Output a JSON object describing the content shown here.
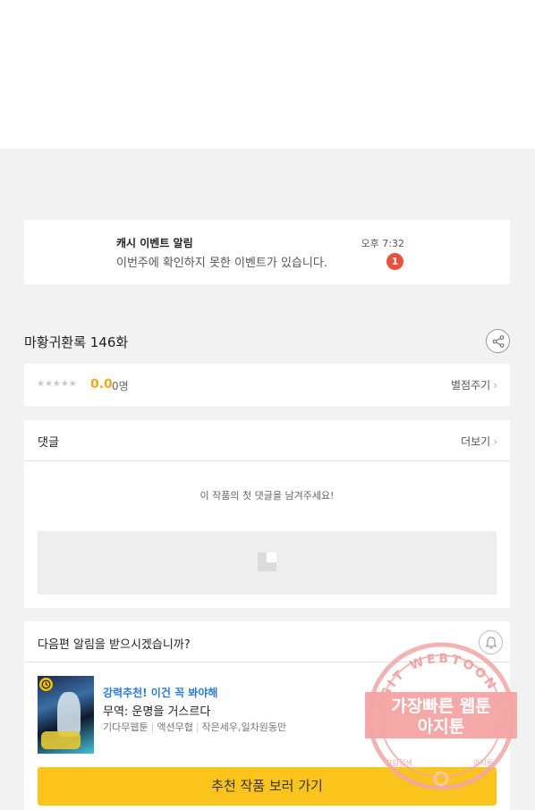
{
  "notification": {
    "title": "캐시 이벤트 알림",
    "body": "이번주에 확인하지 못한 이벤트가 있습니다.",
    "time": "오후 7:32",
    "badge": "1"
  },
  "episode": {
    "title": "마황귀환록 146화"
  },
  "rating": {
    "stars": "★★★★★",
    "score": "0.0",
    "count": "0명",
    "rate_label": "별점주기",
    "chevron": "›"
  },
  "comments": {
    "title": "댓글",
    "more_label": "더보기",
    "chevron": "›",
    "empty_message": "이 작품의 첫 댓글을 남겨주세요!"
  },
  "next_episode": {
    "question": "다음편 알림을 받으시겠습니까?"
  },
  "recommendation": {
    "label": "강력추천! 이건 꼭 봐야해",
    "title": "무역: 운명을 거스르다",
    "tags": [
      "기다무웹툰",
      "액션무협",
      "작은세우,일차원동만"
    ],
    "cta": "추천 작품 보러 가기"
  },
  "watermark": {
    "ring_text": "AGIT WEBTOON",
    "line1": "가장빠른 웹툰",
    "line2": "아지툰",
    "bottom_left": "그림검색",
    "bottom_right": "아지툰"
  },
  "colors": {
    "accent_yellow": "#fbc41d",
    "score_orange": "#f0a81e",
    "badge_red": "#e8513a",
    "link_blue": "#2a7bd6"
  }
}
